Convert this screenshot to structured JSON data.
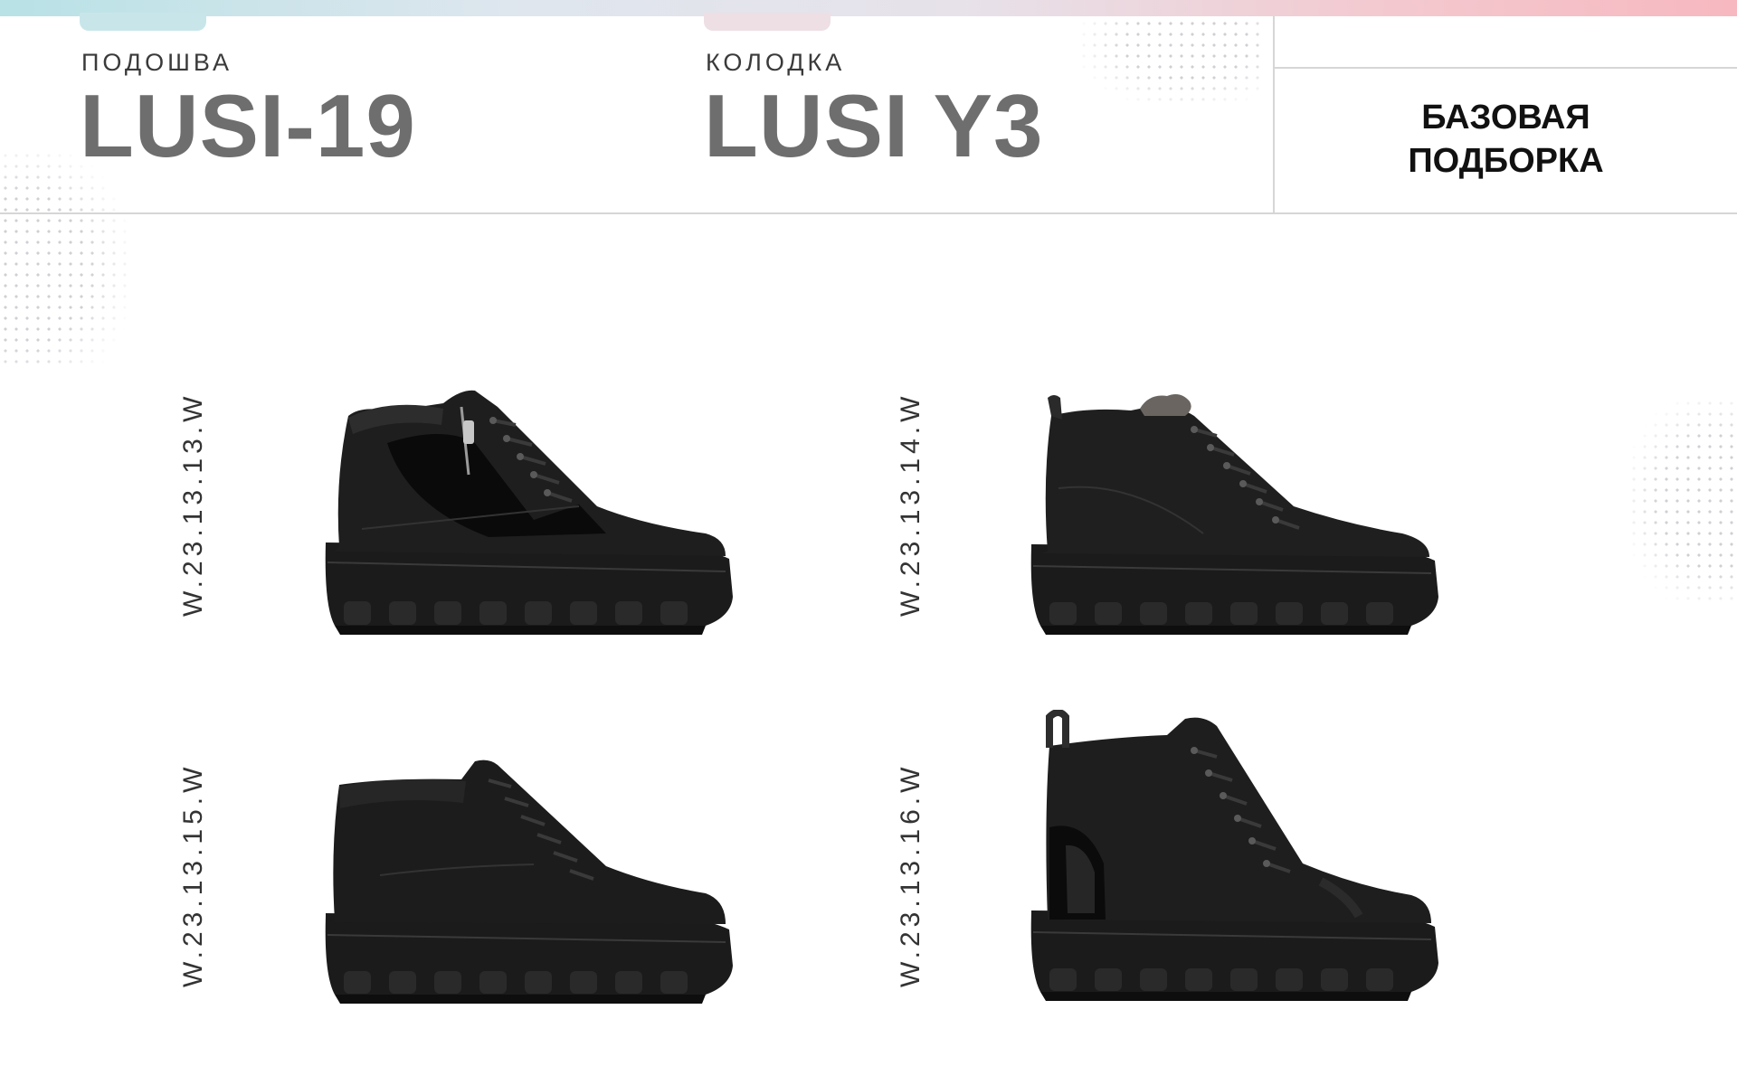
{
  "header": {
    "sole_label": "ПОДОШВА",
    "sole_value": "LUSI-19",
    "last_label": "КОЛОДКА",
    "last_value": "LUSI Y3",
    "collection_line1": "БАЗОВАЯ",
    "collection_line2": "ПОДБОРКА"
  },
  "products": [
    {
      "sku": "W.23.13.13.W",
      "image": "black-leather-suede-zip-ankle-boot"
    },
    {
      "sku": "W.23.13.14.W",
      "image": "black-leather-fur-lined-high-top-sneaker"
    },
    {
      "sku": "W.23.13.15.W",
      "image": "black-leather-high-top-sneaker"
    },
    {
      "sku": "W.23.13.16.W",
      "image": "black-leather-high-top-with-pull-tab"
    }
  ],
  "colors": {
    "title_gray": "#6e6e6e",
    "rule_gray": "#d6d6d6",
    "gradient_start": "#b8e2e6",
    "gradient_end": "#f7b8c0"
  }
}
